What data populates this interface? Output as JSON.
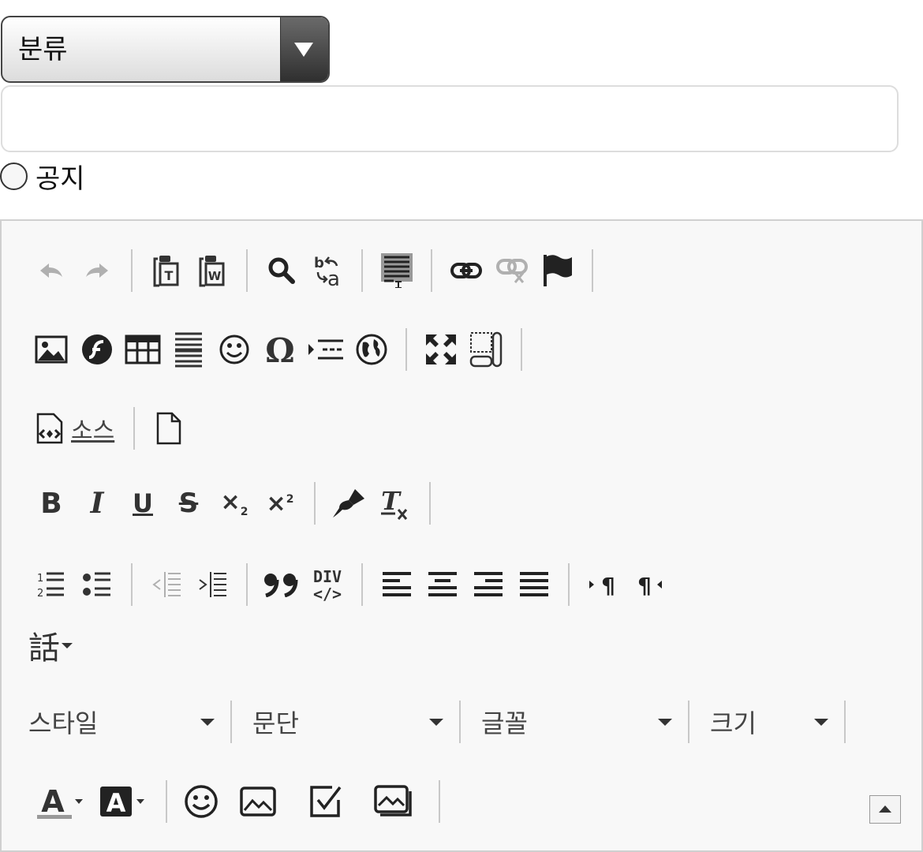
{
  "form": {
    "category_select": {
      "label": "분류"
    },
    "title_input": {
      "value": ""
    },
    "notice": {
      "label": "공지",
      "checked": false
    }
  },
  "editor": {
    "colors": {
      "active_icon": "#333333",
      "disabled_icon": "#b0b0b0",
      "background": "#f8f8f8",
      "border": "#d0d0d0"
    },
    "rows": [
      {
        "buttons": [
          "undo-icon",
          "redo-icon",
          "|",
          "paste-text-icon",
          "paste-word-icon",
          "|",
          "find-icon",
          "replace-icon",
          "|",
          "select-all-icon",
          "|",
          "link-icon",
          "unlink-icon",
          "anchor-icon",
          "|"
        ]
      },
      {
        "buttons": [
          "image-icon",
          "flash-icon",
          "table-icon",
          "horizontal-rule-icon",
          "smiley-icon",
          "special-char-icon",
          "page-break-icon",
          "iframe-icon",
          "|",
          "maximize-icon",
          "show-blocks-icon",
          "|"
        ]
      },
      {
        "buttons": [
          "source-icon",
          "|",
          "new-page-icon"
        ]
      },
      {
        "buttons": [
          "bold-icon",
          "italic-icon",
          "underline-icon",
          "strike-icon",
          "subscript-icon",
          "superscript-icon",
          "|",
          "copy-format-icon",
          "remove-format-icon",
          "|"
        ]
      },
      {
        "buttons": [
          "numbered-list-icon",
          "bulleted-list-icon",
          "|",
          "outdent-icon",
          "indent-icon",
          "|",
          "blockquote-icon",
          "create-div-icon",
          "|",
          "align-left-icon",
          "align-center-icon",
          "align-right-icon",
          "align-justify-icon",
          "|",
          "ltr-icon",
          "rtl-icon"
        ]
      },
      {
        "buttons": [
          "language-icon"
        ]
      },
      {
        "buttons": [
          "text-color-icon",
          "bg-color-icon",
          "|",
          "emoji-icon",
          "image2-icon",
          "checkbox-icon",
          "image-gallery-icon",
          "|"
        ]
      }
    ],
    "source_label": "소스",
    "language_glyph": "話",
    "combos": [
      {
        "label": "스타일"
      },
      {
        "label": "문단"
      },
      {
        "label": "글꼴"
      },
      {
        "label": "크기"
      }
    ]
  }
}
